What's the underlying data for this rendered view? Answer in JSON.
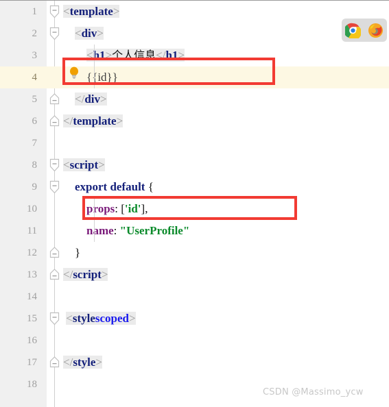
{
  "app": {
    "type": "code-editor",
    "filetype": "vue-sfc",
    "total_lines": 18
  },
  "colors": {
    "gutter_bg": "#f0f0f0",
    "editor_bg": "#ffffff",
    "current_line_bg": "#fdf8e3",
    "annotation_red": "#f23b33",
    "tag_navy": "#14207a",
    "attr_blue": "#1a1aee",
    "string_green": "#0a8a2a",
    "property_purple": "#7a1a7a",
    "punct_gray": "#9a9a9a",
    "linenum_gray": "#a0a0a0",
    "watermark_gray": "#c8c8c8",
    "browser_panel_bg": "#dcdcdc",
    "bulb_amber": "#f0a000"
  },
  "lines": [
    {
      "num": "1",
      "fold": "open",
      "indent": 0,
      "current": false,
      "tokens": [
        {
          "text": "<",
          "cls": "t-punct"
        },
        {
          "text": "template",
          "cls": "t-tag"
        },
        {
          "text": ">",
          "cls": "t-punct"
        }
      ]
    },
    {
      "num": "2",
      "fold": "open",
      "indent": 1,
      "current": false,
      "tokens": [
        {
          "text": "    ",
          "cls": "t-plain"
        },
        {
          "text": "<",
          "cls": "t-punct"
        },
        {
          "text": "div",
          "cls": "t-tag"
        },
        {
          "text": ">",
          "cls": "t-punct"
        }
      ]
    },
    {
      "num": "3",
      "fold": "none",
      "indent": 2,
      "current": false,
      "tokens": [
        {
          "text": "        ",
          "cls": "t-plain"
        },
        {
          "text": "<",
          "cls": "t-punct"
        },
        {
          "text": "h1",
          "cls": "t-tag"
        },
        {
          "text": ">",
          "cls": "t-punct"
        },
        {
          "text": "个人信息",
          "cls": "t-han"
        },
        {
          "text": "</",
          "cls": "t-punct"
        },
        {
          "text": "h1",
          "cls": "t-tag"
        },
        {
          "text": ">",
          "cls": "t-punct"
        }
      ]
    },
    {
      "num": "4",
      "fold": "none",
      "indent": 2,
      "current": true,
      "bulb": true,
      "tokens": [
        {
          "text": "        ",
          "cls": "t-plain"
        },
        {
          "text": "{{id}}",
          "cls": "t-brace"
        }
      ]
    },
    {
      "num": "5",
      "fold": "close",
      "indent": 1,
      "current": false,
      "tokens": [
        {
          "text": "    ",
          "cls": "t-plain"
        },
        {
          "text": "</",
          "cls": "t-punct"
        },
        {
          "text": "div",
          "cls": "t-tag"
        },
        {
          "text": ">",
          "cls": "t-punct"
        }
      ]
    },
    {
      "num": "6",
      "fold": "close",
      "indent": 0,
      "current": false,
      "tokens": [
        {
          "text": "</",
          "cls": "t-punct"
        },
        {
          "text": "template",
          "cls": "t-tag"
        },
        {
          "text": ">",
          "cls": "t-punct"
        }
      ]
    },
    {
      "num": "7",
      "fold": "none",
      "indent": 0,
      "current": false,
      "tokens": []
    },
    {
      "num": "8",
      "fold": "open",
      "indent": 0,
      "current": false,
      "tokens": [
        {
          "text": "<",
          "cls": "t-punct"
        },
        {
          "text": "script",
          "cls": "t-tag"
        },
        {
          "text": ">",
          "cls": "t-punct"
        }
      ]
    },
    {
      "num": "9",
      "fold": "open",
      "indent": 1,
      "current": false,
      "tokens": [
        {
          "text": "    ",
          "cls": "t-plain"
        },
        {
          "text": "export default",
          "cls": "t-kw"
        },
        {
          "text": " {",
          "cls": "t-plain"
        }
      ]
    },
    {
      "num": "10",
      "fold": "none",
      "indent": 2,
      "current": false,
      "tokens": [
        {
          "text": "        ",
          "cls": "t-plain"
        },
        {
          "text": "props",
          "cls": "t-prop"
        },
        {
          "text": ": [",
          "cls": "t-plain"
        },
        {
          "text": "'id'",
          "cls": "t-str-sq"
        },
        {
          "text": "],",
          "cls": "t-plain"
        }
      ]
    },
    {
      "num": "11",
      "fold": "none",
      "indent": 2,
      "current": false,
      "tokens": [
        {
          "text": "        ",
          "cls": "t-plain"
        },
        {
          "text": "name",
          "cls": "t-prop"
        },
        {
          "text": ": ",
          "cls": "t-plain"
        },
        {
          "text": "\"UserProfile\"",
          "cls": "t-str"
        }
      ]
    },
    {
      "num": "12",
      "fold": "close",
      "indent": 1,
      "current": false,
      "tokens": [
        {
          "text": "    }",
          "cls": "t-plain"
        }
      ]
    },
    {
      "num": "13",
      "fold": "close",
      "indent": 0,
      "current": false,
      "tokens": [
        {
          "text": "</",
          "cls": "t-punct"
        },
        {
          "text": "script",
          "cls": "t-tag"
        },
        {
          "text": ">",
          "cls": "t-punct"
        }
      ]
    },
    {
      "num": "14",
      "fold": "none",
      "indent": 0,
      "current": false,
      "tokens": []
    },
    {
      "num": "15",
      "fold": "open",
      "indent": 0,
      "current": false,
      "tokens": [
        {
          "text": "<",
          "cls": "t-punct"
        },
        {
          "text": "style",
          "cls": "t-tag"
        },
        {
          "text": " ",
          "cls": "t-plain"
        },
        {
          "text": "scoped",
          "cls": "t-attr"
        },
        {
          "text": ">",
          "cls": "t-punct"
        }
      ]
    },
    {
      "num": "16",
      "fold": "none",
      "indent": 0,
      "current": false,
      "tokens": []
    },
    {
      "num": "17",
      "fold": "close",
      "indent": 0,
      "current": false,
      "tokens": [
        {
          "text": "</",
          "cls": "t-punct"
        },
        {
          "text": "style",
          "cls": "t-tag"
        },
        {
          "text": ">",
          "cls": "t-punct"
        }
      ]
    },
    {
      "num": "18",
      "fold": "none",
      "indent": 0,
      "current": false,
      "tokens": []
    }
  ],
  "annotations": [
    {
      "id": "redbox-1",
      "label": "highlight-interpolation-line"
    },
    {
      "id": "redbox-2",
      "label": "highlight-props-line"
    }
  ],
  "browser_panel": {
    "icons": [
      "chrome-icon",
      "firefox-icon"
    ]
  },
  "watermark": {
    "text": "CSDN @Massimo_ycw"
  }
}
